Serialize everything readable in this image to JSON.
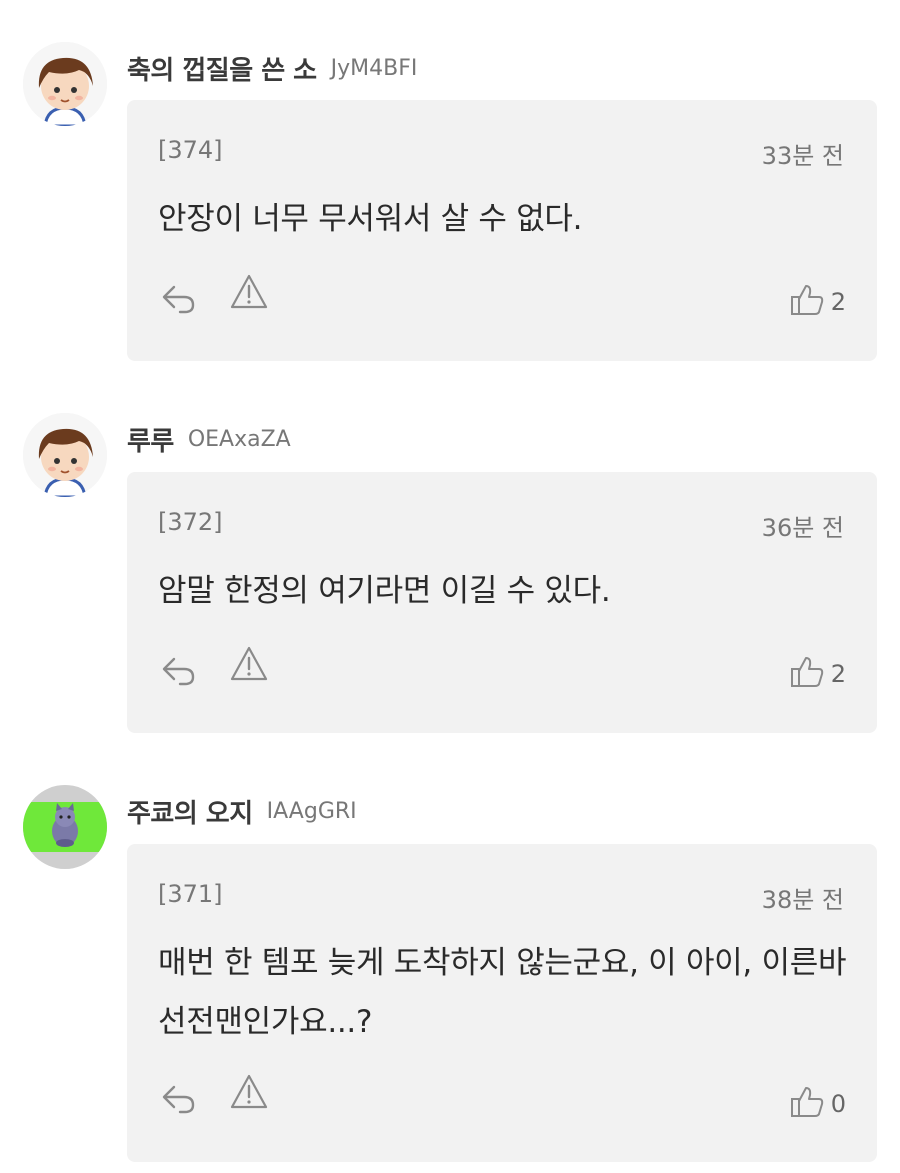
{
  "comments": [
    {
      "nickname": "축의 껍질을 쓴 소",
      "user_id": "JyM4BFI",
      "number": "[374]",
      "time": "33분 전",
      "text": "안장이 너무 무서워서 살 수 없다.",
      "likes": "2",
      "avatar": "boy-avatar"
    },
    {
      "nickname": "루루",
      "user_id": "OEAxaZA",
      "number": "[372]",
      "time": "36분 전",
      "text": "암말 한정의 여기라면 이길 수 있다.",
      "likes": "2",
      "avatar": "boy-avatar"
    },
    {
      "nickname": "주쿄의 오지",
      "user_id": "IAAgGRI",
      "number": "[371]",
      "time": "38분 전",
      "text": "매번 한 템포 늦게 도착하지 않는군요, 이 아이, 이른바 선전맨인가요...?",
      "likes": "0",
      "avatar": "cat-avatar"
    }
  ],
  "colors": {
    "bubble": "#f2f2f2",
    "icon": "#8a8a8a",
    "avatar_green": "#6fe83a"
  }
}
